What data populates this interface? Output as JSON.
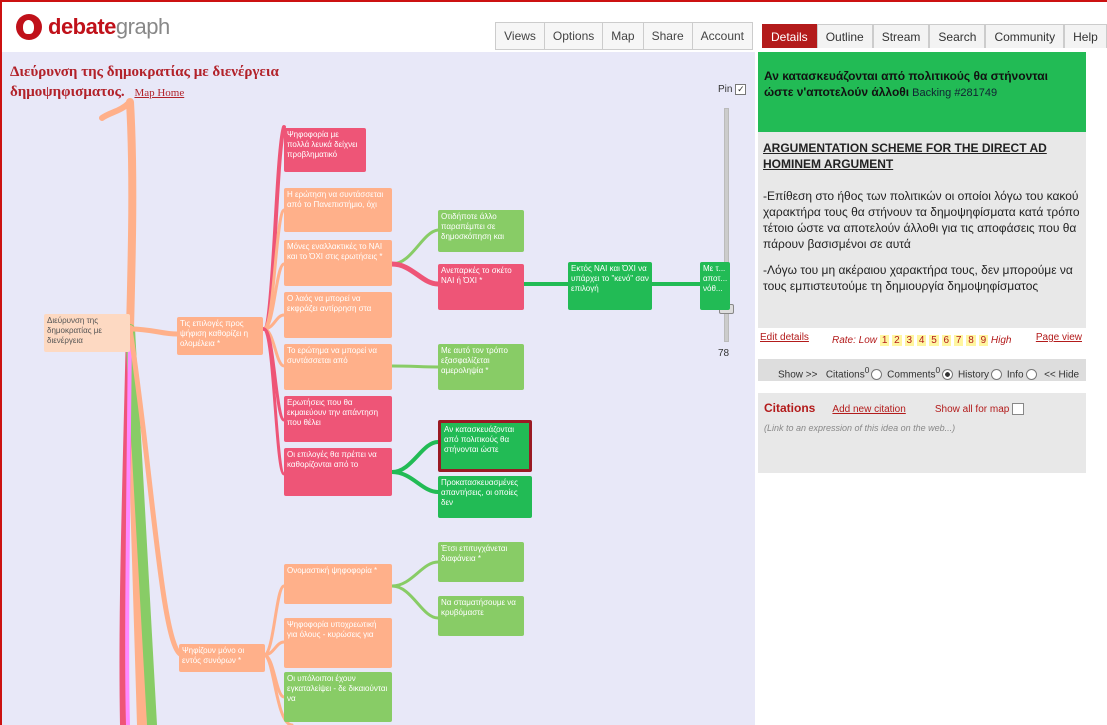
{
  "header": {
    "logo_brand": "debate",
    "logo_suffix": "graph",
    "nav": [
      "Views",
      "Options",
      "Map",
      "Share",
      "Account"
    ]
  },
  "map": {
    "title": "Διεύρυνση της δημοκρατίας με διενέργεια δημοψηφισματος.",
    "map_home": "Map Home",
    "pin_label": "Pin",
    "pin_checked": "✓",
    "slider_value": "78",
    "nodes": {
      "root": "Διεύρυνση της δημοκρατίας με διενέργεια",
      "n_choices": "Τις επιλογές προς ψήφιση καθορίζει η ολομέλεια *",
      "n_neighbors": "Ψηφίζουν μόνο οι εντός συνόρων *",
      "n_blank": "Ψηφοφορία με πολλά λευκά δείχνει προβληματικό",
      "n_question": "Η ερώτηση να συντάσσεται από το Πανεπιστήμιο, όχι",
      "n_only_yesno": "Μόνες εναλλακτικές το ΝΑΙ και το ΌΧΙ στις ερωτήσεις *",
      "n_people": "Ο λαός να μπορεί να εκφράζει αντίρρηση στα",
      "n_compose": "Το ερώτημα να μπορεί να συντάσσεται από",
      "n_questions_answers": "Ερωτήσεις που θα εκμαιεύουν την απάντηση που θέλει",
      "n_choices_set": "Οι επιλογές θα πρέπει να καθορίζονται από το",
      "n_anything": "Οτιδήποτε άλλο παραπέμπει σε δημοσκόπηση και",
      "n_insufficient": "Ανεπαρκές το σκέτο ΝΑΙ ή ΌΧΙ *",
      "n_blank_choice": "Εκτός ΝΑΙ και ΌΧΙ να υπάρχει το \"κενό\" σαν επιλογή",
      "n_far": "Με τ... αποτ... νόθ...",
      "n_impartial": "Με αυτό τον τρόπο εξασφαλίζεται αμεροληψία *",
      "n_selected": "Αν κατασκευάζονται από πολιτικούς θα στήνονται ώστε",
      "n_preset": "Προκατασκευασμένες απαντήσεις, οι οποίες δεν",
      "n_nominal": "Ονομαστική ψηφοφορία *",
      "n_mandatory": "Ψηφοφορία υποχρεωτική για όλους - κυρώσεις για",
      "n_others": "Οι υπόλοιποι έχουν εγκαταλείψει - δε δικαιούνται να",
      "n_transparency": "Έτσι επιτυγχάνεται διαφάνεια *",
      "n_hide": "Να σταματήσουμε να κρυβόμαστε"
    }
  },
  "panel": {
    "tabs": [
      "Details",
      "Outline",
      "Stream",
      "Search",
      "Community",
      "Help"
    ],
    "active_tab": "Details",
    "idea_title": "Αν κατασκευάζονται από πολιτικούς θα στήνονται ώστε ν'αποτελούν άλλοθι",
    "backing": "Backing #281749",
    "heading": "ARGUMENTATION SCHEME FOR THE DIRECT AD HOMINEM ARGUMENT",
    "para1": "-Επίθεση στο ήθος των πολιτικών οι οποίοι λόγω του κακού χαρακτήρα τους θα στήνουν τα δημοψηφίσματα κατά τρόπο τέτοιο ώστε να αποτελούν άλλοθι για τις αποφάσεις που θα πάρουν βασισμένοι σε αυτά",
    "para2": "-Λόγω του μη ακέραιου χαρακτήρα τους, δεν μπορούμε να τους εμπιστευτούμε τη δημιουργία δημοψηφίσματος",
    "edit_details": "Edit details",
    "rate_label": "Rate: Low",
    "rate_numbers": [
      "1",
      "2",
      "3",
      "4",
      "5",
      "6",
      "7",
      "8",
      "9"
    ],
    "rate_high": "High",
    "page_view": "Page view",
    "show_label": "Show >>",
    "citations_label": "Citations",
    "citations_count": "0",
    "comments_label": "Comments",
    "comments_count": "0",
    "history_label": "History",
    "info_label": "Info",
    "hide_label": "<< Hide",
    "citations_title": "Citations",
    "add_citation": "Add new citation",
    "show_all": "Show all for map",
    "citation_note": "(Link to an expression of this idea on the web...)"
  }
}
